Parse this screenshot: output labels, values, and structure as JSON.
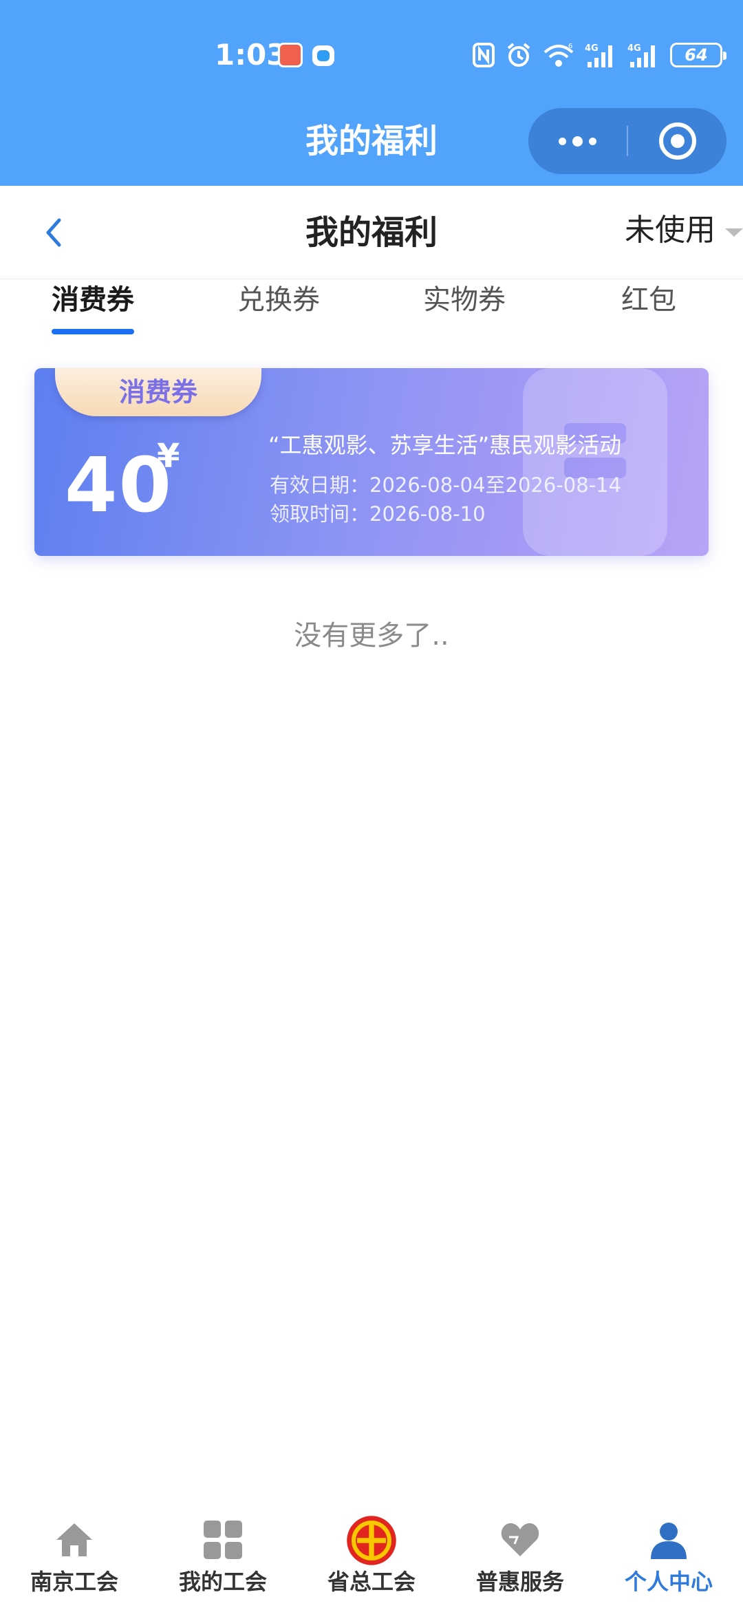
{
  "status_bar": {
    "time": "1:03",
    "battery": "64",
    "icons": [
      "nfc-icon",
      "alarm-icon",
      "wifi-icon",
      "signal-4g-icon",
      "signal-4g-icon",
      "battery-icon"
    ]
  },
  "miniprogram": {
    "title": "我的福利",
    "more_icon": "more-dots-icon",
    "close_icon": "target-close-icon"
  },
  "nav": {
    "title": "我的福利",
    "filter_label": "未使用",
    "back_icon": "chevron-left-icon"
  },
  "tabs": [
    {
      "label": "消费券",
      "active": true
    },
    {
      "label": "兑换券",
      "active": false
    },
    {
      "label": "实物券",
      "active": false
    },
    {
      "label": "红包",
      "active": false
    }
  ],
  "coupons": [
    {
      "tag": "消费券",
      "amount": "40",
      "currency": "¥",
      "title": "“工惠观影、苏享生活”惠民观影活动",
      "valid_text": "有效日期：2026-08-04至2026-08-14",
      "claim_text": "领取时间：2026-08-10"
    }
  ],
  "empty_hint": "没有更多了..",
  "tabbar": [
    {
      "label": "南京工会",
      "icon": "home-icon",
      "active": false
    },
    {
      "label": "我的工会",
      "icon": "grid-icon",
      "active": false
    },
    {
      "label": "省总工会",
      "icon": "union-emblem-icon",
      "active": false
    },
    {
      "label": "普惠服务",
      "icon": "heart-icon",
      "active": false
    },
    {
      "label": "个人中心",
      "icon": "person-icon",
      "active": true
    }
  ],
  "colors": {
    "header_blue": "#51a3fb",
    "tab_underline": "#1c6ef2",
    "coupon_gradient_start": "#5c7ff0",
    "coupon_gradient_end": "#b7a4f7",
    "tabbar_active": "#2f7bdc"
  }
}
